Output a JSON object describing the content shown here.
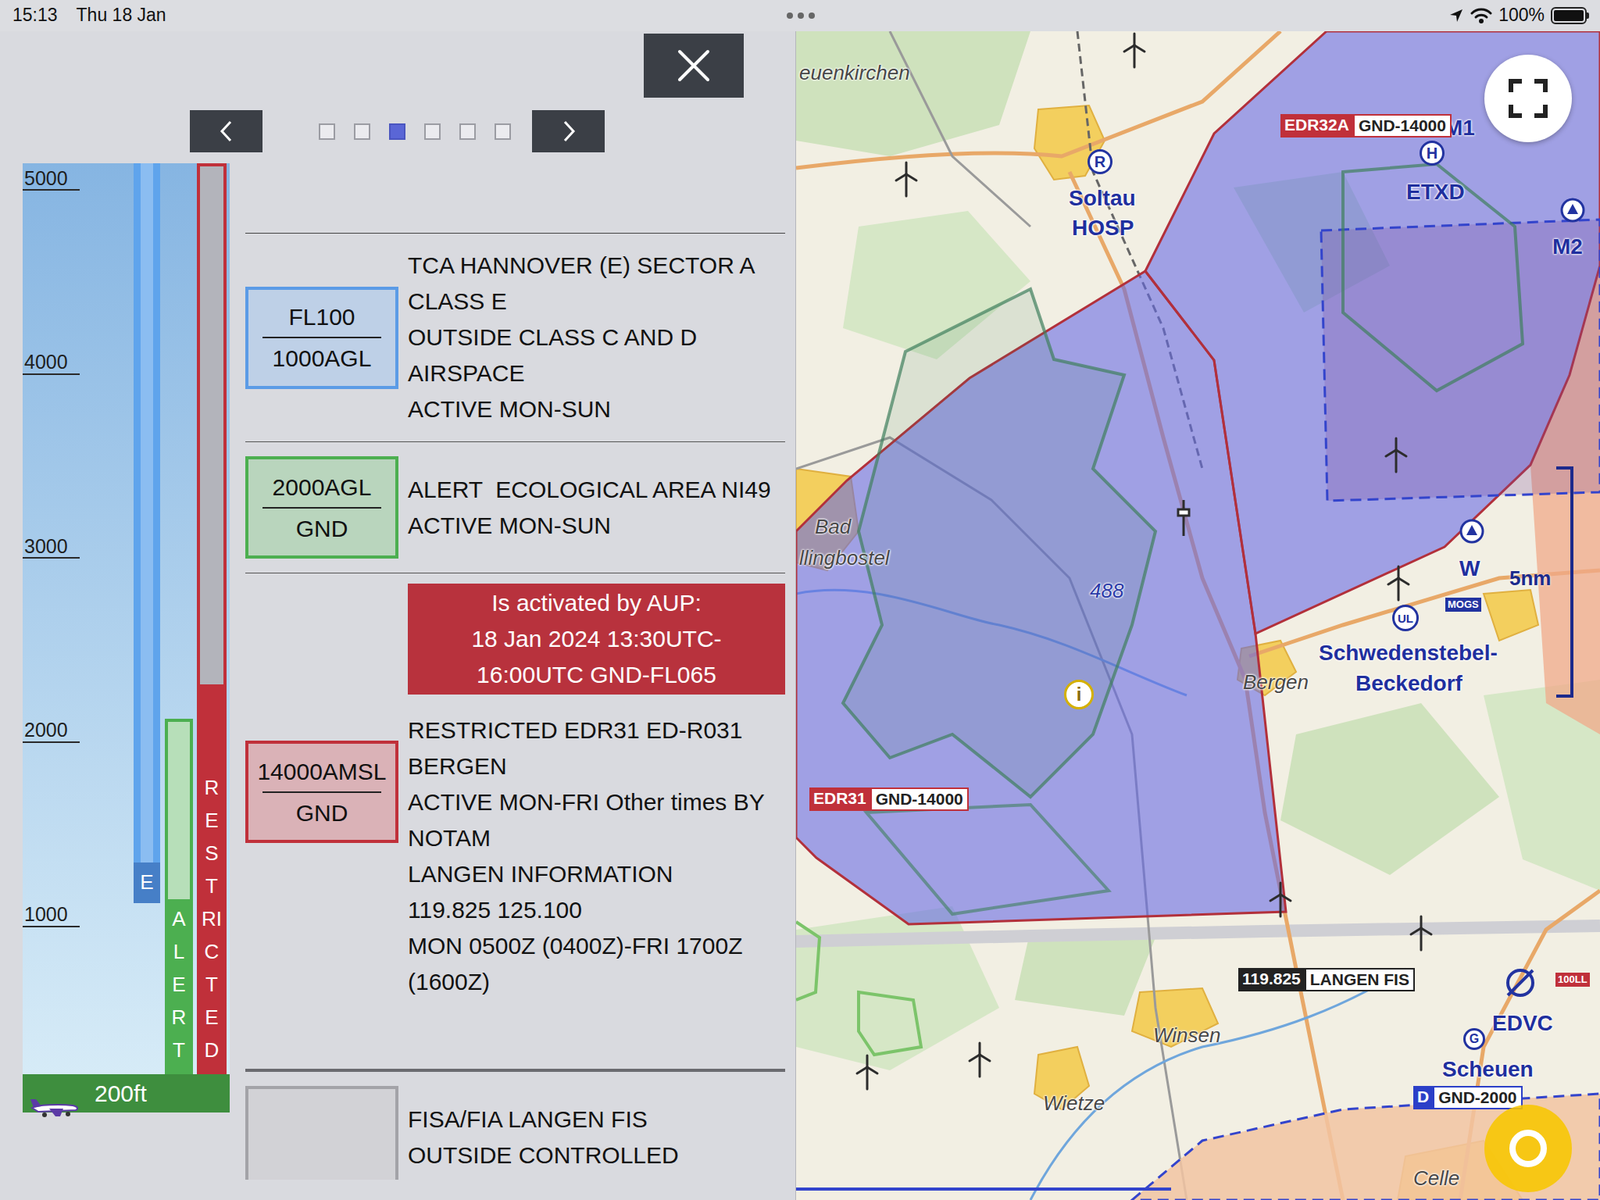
{
  "status_bar": {
    "time": "15:13",
    "date": "Thu 18 Jan",
    "battery": "100%",
    "battery_level": 1
  },
  "panel": {
    "pages": [
      {
        "selected": false
      },
      {
        "selected": false
      },
      {
        "selected": true
      },
      {
        "selected": false
      },
      {
        "selected": false
      },
      {
        "selected": false
      }
    ],
    "profile": {
      "axis_min_ft": 200,
      "axis_max_ft": 5150,
      "ticks": [
        {
          "label": "5000",
          "ft": 5000
        },
        {
          "label": "4000",
          "ft": 4000
        },
        {
          "label": "3000",
          "ft": 3000
        },
        {
          "label": "2000",
          "ft": 2000
        },
        {
          "label": "1000",
          "ft": 1000
        }
      ],
      "bars": [
        {
          "label": "E",
          "kind": "class",
          "color": "#5fa4ec",
          "bottom_ft": 1130,
          "top_ft": 5150
        },
        {
          "label": "ALERT",
          "kind": "alert",
          "color": "#4caf50",
          "bottom_ft": 200,
          "top_ft": 2130
        },
        {
          "label": "RESTRICTED",
          "kind": "restricted",
          "color": "#c0303a",
          "bottom_ft": 200,
          "top_ft": 5150,
          "active_top_ft": 2320
        }
      ],
      "aircraft_altitude": "200ft"
    },
    "groups": [
      {
        "entries": [
          {
            "top": "FL100",
            "bottom": "1000AGL",
            "color": "#5b9be6",
            "lines": [
              "TCA HANNOVER (E) SECTOR A",
              "CLASS E",
              "OUTSIDE CLASS C AND D",
              "AIRSPACE",
              "ACTIVE MON-SUN"
            ]
          },
          {
            "top": "2000AGL",
            "bottom": "GND",
            "color": "#4caf50",
            "lines": [
              "ALERT  ECOLOGICAL AREA NI49",
              "ACTIVE MON-SUN"
            ]
          },
          {
            "top": "14000AMSL",
            "bottom": "GND",
            "color": "#c0303a",
            "activation": [
              "Is activated by AUP:",
              "18 Jan 2024 13:30UTC-",
              "16:00UTC GND-FL065"
            ],
            "lines": [
              "RESTRICTED EDR31 ED-R031",
              "BERGEN",
              "ACTIVE MON-FRI Other times BY",
              "NOTAM",
              "LANGEN INFORMATION",
              "119.825 125.100",
              "MON 0500Z (0400Z)-FRI 1700Z",
              "(1600Z)"
            ]
          }
        ]
      },
      {
        "entries": [
          {
            "color": "#a3a3a8",
            "lines": [
              "FISA/FIA LANGEN FIS",
              "OUTSIDE CONTROLLED"
            ]
          }
        ]
      }
    ]
  },
  "map": {
    "places": [
      {
        "name": "euenkirchen",
        "kind": "town"
      },
      {
        "name": "Soltau",
        "kind": "airfield"
      },
      {
        "name": "HOSP",
        "kind": "airfield"
      },
      {
        "name": "ETXD",
        "kind": "airfield"
      },
      {
        "name": "M1",
        "kind": "airfield"
      },
      {
        "name": "M2",
        "kind": "airfield"
      },
      {
        "name": "Bad",
        "kind": "town"
      },
      {
        "name": "llingbostel",
        "kind": "town"
      },
      {
        "name": "488",
        "kind": "elevation"
      },
      {
        "name": "W",
        "kind": "airfield"
      },
      {
        "name": "Schwedenstebel-",
        "kind": "airfield"
      },
      {
        "name": "Beckedorf",
        "kind": "airfield"
      },
      {
        "name": "Bergen",
        "kind": "town"
      },
      {
        "name": "Winsen",
        "kind": "town"
      },
      {
        "name": "Wietze",
        "kind": "town"
      },
      {
        "name": "EDVC",
        "kind": "airfield"
      },
      {
        "name": "Scheuen",
        "kind": "airfield"
      },
      {
        "name": "Celle",
        "kind": "town"
      }
    ],
    "airspace_tags": [
      {
        "name": "EDR32A",
        "limits": "GND-14000",
        "color": "#c0303a"
      },
      {
        "name": "EDR31",
        "limits": "GND-14000",
        "color": "#c0303a"
      },
      {
        "name": "D",
        "limits": "GND-2000",
        "color": "#2b3fc8"
      }
    ],
    "frequency": {
      "value": "119.825",
      "station": "LANGEN FIS"
    },
    "symbols": [
      {
        "glyph": "R",
        "color": "#2233a0"
      },
      {
        "glyph": "H",
        "color": "#2233a0"
      },
      {
        "glyph": "UL",
        "color": "#2233a0"
      },
      {
        "glyph": "i",
        "color": "#d4b000"
      },
      {
        "glyph": "G",
        "color": "#2233a0"
      }
    ],
    "badges": [
      {
        "text": "MOGS",
        "color": "#2233a0"
      },
      {
        "text": "100LL",
        "color": "#c0303a"
      }
    ],
    "scale": "5nm"
  }
}
